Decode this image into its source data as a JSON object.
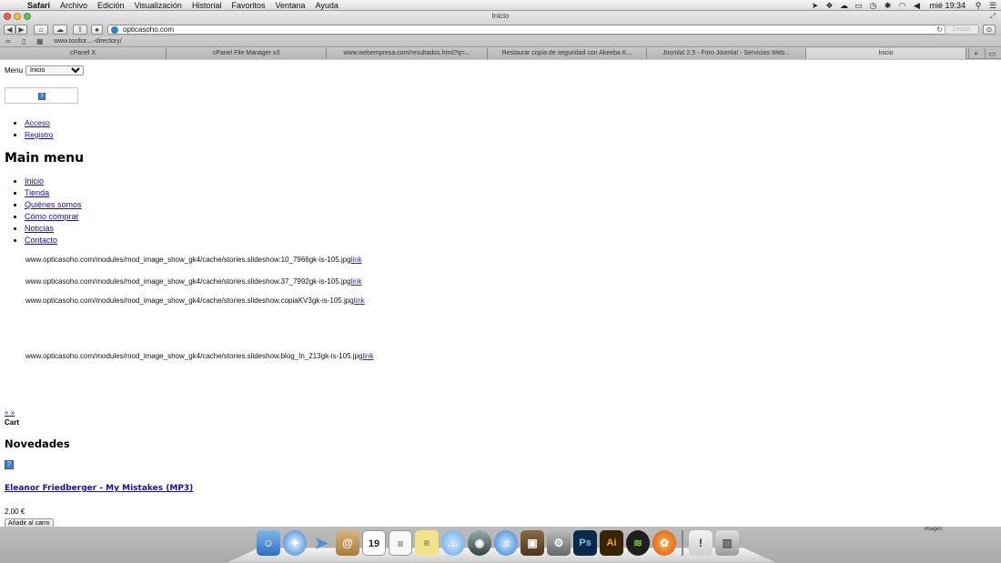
{
  "menubar": {
    "app": "Safari",
    "items": [
      "Archivo",
      "Edición",
      "Visualización",
      "Historial",
      "Favoritos",
      "Ventana",
      "Ayuda"
    ],
    "clock": "mié 19:34"
  },
  "window": {
    "title": "Inicio"
  },
  "toolbar": {
    "url": "opticasoho.com",
    "reader": "Lector"
  },
  "bookmarks": {
    "item": "www.tooltor....-directory/"
  },
  "tabs": [
    "cPanel X",
    "cPanel File Manager v3",
    "www.webempresa.com/resultados.html?q=...",
    "Restaurar copia de seguridad con Akeeba K...",
    "Joomla! 2.5 - Foro Joomla! - Servicios Web...",
    "Inicio"
  ],
  "page": {
    "menu_label": "Menu",
    "menu_select": "Inicio",
    "login_links": [
      "Acceso",
      "Registro"
    ],
    "main_menu_title": "Main menu",
    "main_menu": [
      "Inicio",
      "Tienda",
      "Quiénes somos",
      "Cómo comprar",
      "Noticias",
      "Contacto"
    ],
    "slides": [
      {
        "path": "www.opticasoho.com/modules/mod_image_show_gk4/cache/stories.slideshow.10_7966gk-is-105.jpg",
        "link": "link"
      },
      {
        "path": "www.opticasoho.com/modules/mod_image_show_gk4/cache/stories.slideshow.37_7992gk-is-105.jpg",
        "link": "link"
      },
      {
        "path": "www.opticasoho.com/modules/mod_image_show_gk4/cache/stories.slideshow.copiaKV3gk-is-105.jpg",
        "link": "link"
      },
      {
        "path": "www.opticasoho.com/modules/mod_image_show_gk4/cache/stories.slideshow.blog_In_213gk-is-105.jpg",
        "link": "link"
      }
    ],
    "pager": "« »",
    "cart": "Cart",
    "novedades_title": "Novedades",
    "product": {
      "name": "Eleanor Friedberger - My Mistakes (MP3)",
      "price": "2,00 €",
      "add_button": "Añadir al carro"
    }
  },
  "dock": {
    "apps": [
      "Finder",
      "Safari",
      "Mail",
      "Address Book",
      "Calendar",
      "Notes",
      "Stickies",
      "Messages",
      "Camera",
      "iTunes",
      "Preview",
      "System Preferences",
      "Photoshop",
      "Illustrator",
      "Spotify",
      "Firefox",
      "Archive",
      "Trash"
    ],
    "calendar_day": "19",
    "ps_label": "Ps",
    "ai_label": "Ai",
    "image_tag": "imagen"
  }
}
